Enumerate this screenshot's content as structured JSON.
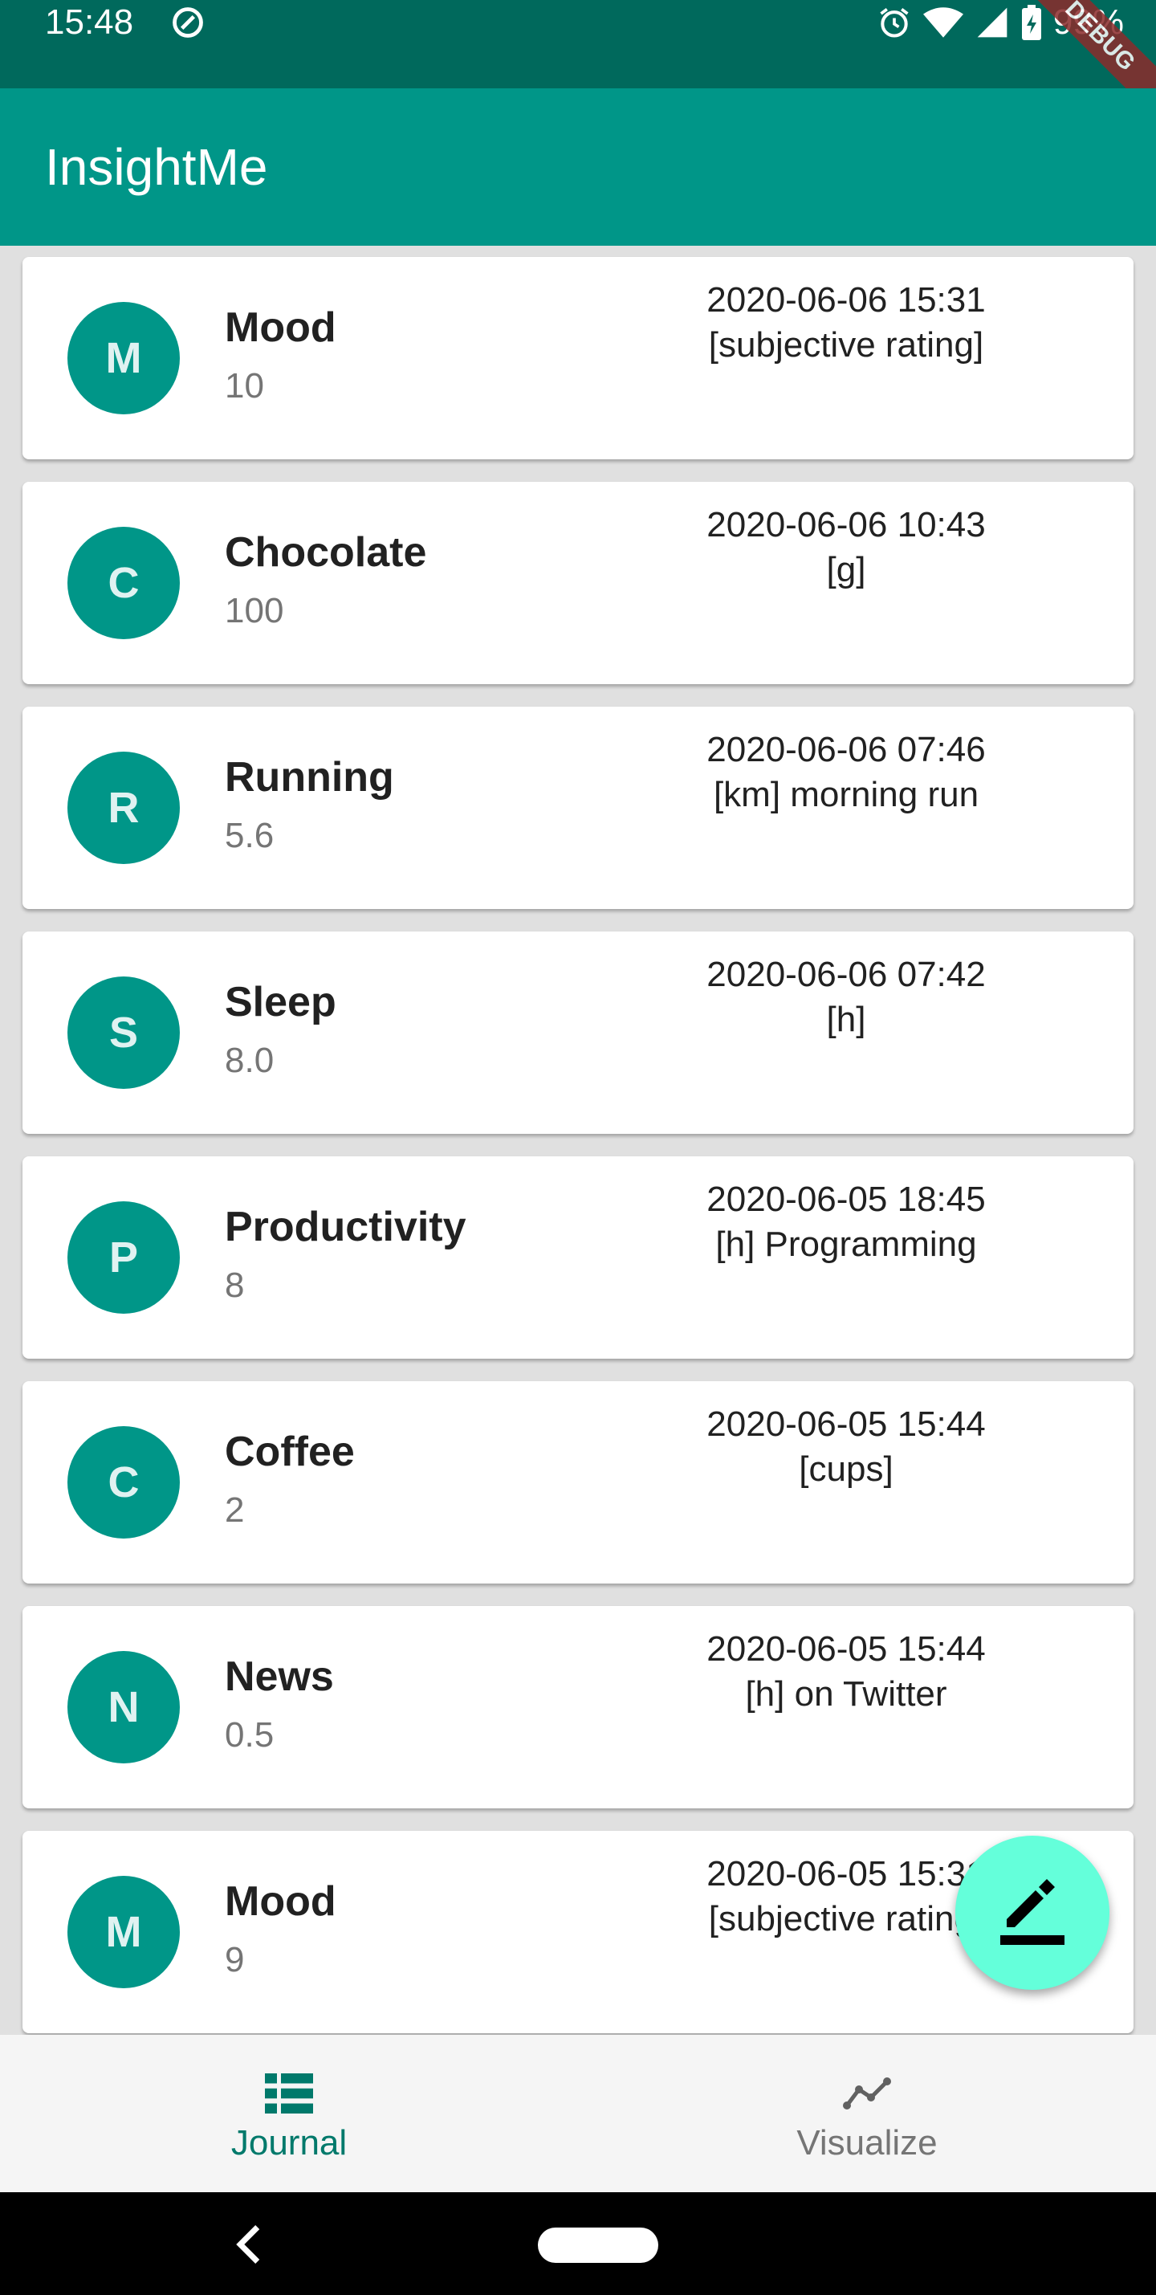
{
  "status_bar": {
    "time": "15:48",
    "battery": "99%",
    "debug_banner": "DEBUG"
  },
  "app_bar": {
    "title": "InsightMe"
  },
  "entries": [
    {
      "initial": "M",
      "name": "Mood",
      "value": "10",
      "datetime": "2020-06-06 15:31",
      "note": "[subjective rating]"
    },
    {
      "initial": "C",
      "name": "Chocolate",
      "value": "100",
      "datetime": "2020-06-06 10:43",
      "note": "[g]"
    },
    {
      "initial": "R",
      "name": "Running",
      "value": "5.6",
      "datetime": "2020-06-06 07:46",
      "note": "[km] morning run"
    },
    {
      "initial": "S",
      "name": "Sleep",
      "value": "8.0",
      "datetime": "2020-06-06 07:42",
      "note": "[h]"
    },
    {
      "initial": "P",
      "name": "Productivity",
      "value": "8",
      "datetime": "2020-06-05 18:45",
      "note": "[h] Programming"
    },
    {
      "initial": "C",
      "name": "Coffee",
      "value": "2",
      "datetime": "2020-06-05 15:44",
      "note": "[cups]"
    },
    {
      "initial": "N",
      "name": "News",
      "value": "0.5",
      "datetime": "2020-06-05 15:44",
      "note": "[h] on Twitter"
    },
    {
      "initial": "M",
      "name": "Mood",
      "value": "9",
      "datetime": "2020-06-05 15:31",
      "note": "[subjective rating]"
    }
  ],
  "fab": {
    "icon": "edit-icon"
  },
  "bottom_nav": [
    {
      "label": "Journal",
      "icon": "journal-list-icon",
      "active": true
    },
    {
      "label": "Visualize",
      "icon": "line-chart-icon",
      "active": false
    }
  ],
  "colors": {
    "primary": "#009688",
    "primary_dark": "#00695c",
    "accent": "#64ffda",
    "active_tab": "#00796b",
    "inactive_tab": "#757575"
  }
}
